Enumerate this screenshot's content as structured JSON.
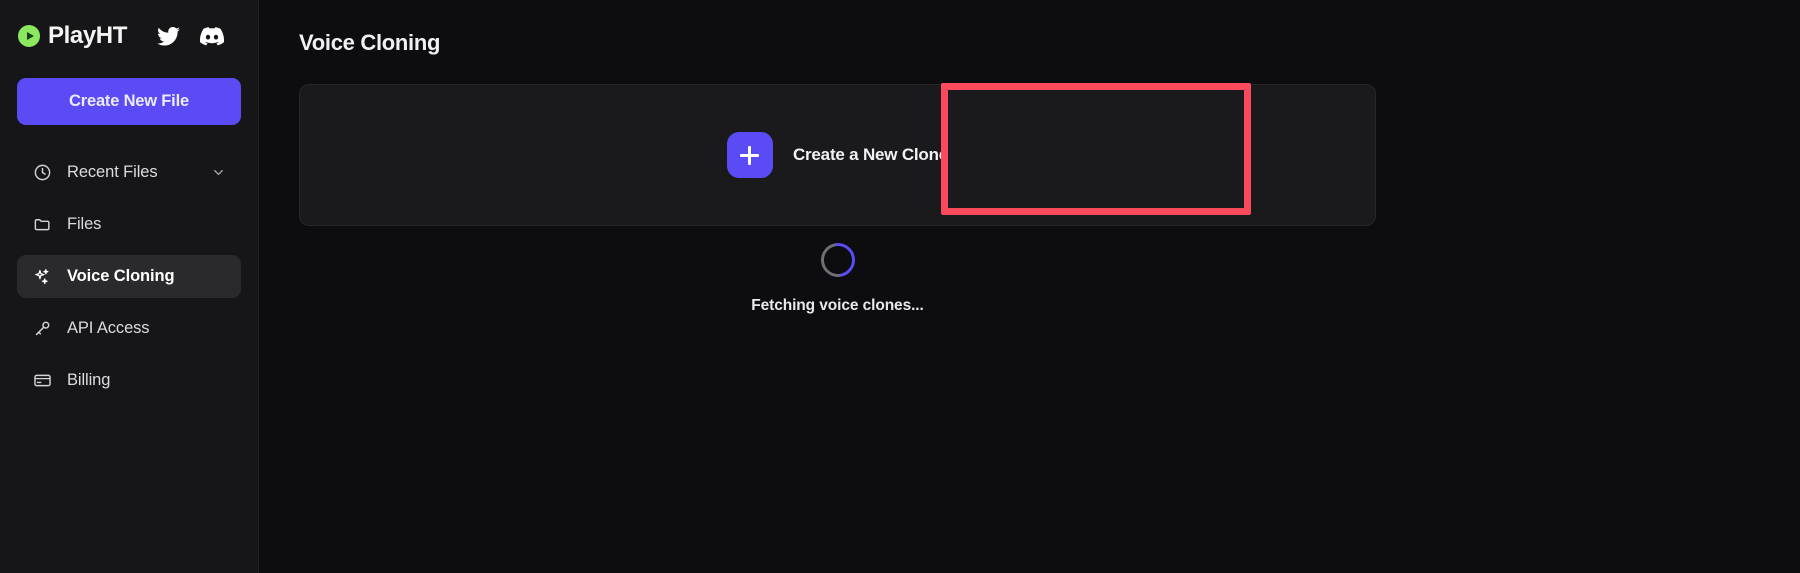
{
  "brand": {
    "name": "PlayHT",
    "logo_icon": "play-circle-icon",
    "logo_color": "#8ce861",
    "socials": [
      {
        "name": "twitter-icon",
        "label": "Twitter"
      },
      {
        "name": "discord-icon",
        "label": "Discord"
      }
    ]
  },
  "sidebar": {
    "cta_label": "Create New File",
    "cta_color": "#5b4bf5",
    "items": [
      {
        "label": "Recent Files",
        "icon": "clock-icon",
        "active": false,
        "has_chevron": true
      },
      {
        "label": "Files",
        "icon": "folder-icon",
        "active": false,
        "has_chevron": false
      },
      {
        "label": "Voice Cloning",
        "icon": "sparkles-icon",
        "active": true,
        "has_chevron": false
      },
      {
        "label": "API Access",
        "icon": "key-icon",
        "active": false,
        "has_chevron": false
      },
      {
        "label": "Billing",
        "icon": "credit-card-icon",
        "active": false,
        "has_chevron": false
      }
    ]
  },
  "main": {
    "page_title": "Voice Cloning",
    "create_clone": {
      "label": "Create a New Clone",
      "icon": "plus-icon",
      "icon_tile_color": "#5b4bf5"
    },
    "loading": {
      "text": "Fetching voice clones...",
      "spinner_color": "#5b4bf5"
    }
  },
  "annotation": {
    "highlight_color": "#fb4a5b",
    "target": "create-a-new-clone-button"
  }
}
